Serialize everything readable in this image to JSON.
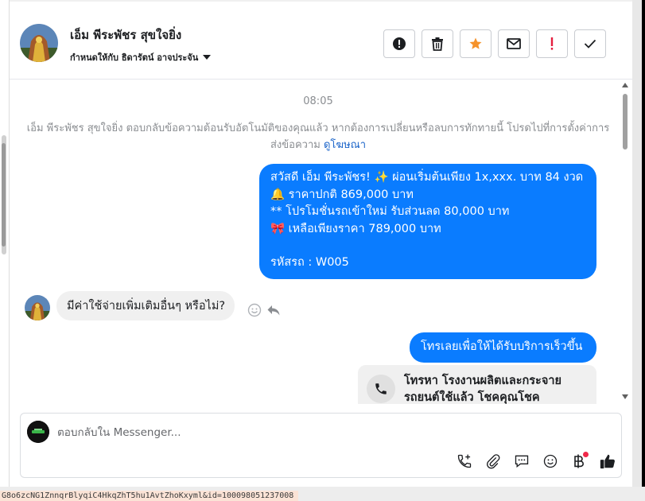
{
  "header": {
    "contact_name": "เอ็ม พีระพัชร สุขใจยิ่ง",
    "assigned_to": "กำหนดให้กับ ธิดารัตน์ อาจประจัน",
    "actions": [
      {
        "icon": "alert-circle-icon",
        "name": "spam-button"
      },
      {
        "icon": "trash-icon",
        "name": "delete-button"
      },
      {
        "icon": "star-icon",
        "name": "star-button",
        "color": "#f5922a"
      },
      {
        "icon": "envelope-icon",
        "name": "mark-unread-button"
      },
      {
        "icon": "exclamation-icon",
        "name": "follow-up-button",
        "color": "#e41e3f"
      },
      {
        "icon": "check-icon",
        "name": "mark-done-button"
      }
    ]
  },
  "messages": {
    "time": "08:05",
    "notice_text": "เอ็ม พีระพัชร สุขใจยิ่ง ตอบกลับข้อความต้อนรับอัตโนมัติของคุณแล้ว หากต้องการเปลี่ยนหรือลบการทักทายนี้ โปรดไปที่การตั้งค่าการส่งข้อความ",
    "notice_link": "ดูโฆษณา",
    "outgoing_1": {
      "line1": "สวัสดี เอ็ม พีระพัชร! ✨  ผ่อนเริ่มต้นเพียง 1x,xxx. บาท 84 งวด",
      "line2": "🔔 ราคาปกติ 869,000 บาท",
      "line3": "** โปรโมชั่นรถเข้าใหม่ รับส่วนลด 80,000 บาท",
      "line4": "🎀  เหลือเพียงราคา 789,000 บาท",
      "line5": "",
      "line6": " รหัสรถ : W005"
    },
    "incoming_1": "มีค่าใช้จ่ายเพิ่มเติมอื่นๆ หรือไม่?",
    "outgoing_2": "โทรเลยเพื่อให้ได้รับบริการเร็วขึ้น",
    "call_card": "โทรหา โรงงานผลิตและกระจายรถยนต์ใช้แล้ว โชคคุณโชค"
  },
  "composer": {
    "placeholder": "ตอบกลับใน Messenger...",
    "tools": [
      "call-add-icon",
      "paperclip-icon",
      "chat-bubble-icon",
      "emoji-icon",
      "baht-icon",
      "thumbs-up-icon"
    ],
    "accent": "#0a7cff"
  },
  "status_url": "G8o6zcNG1ZnnqrBlyqiC4HkqZhT5hu1AvtZhoKxyml&id=100098051237008"
}
